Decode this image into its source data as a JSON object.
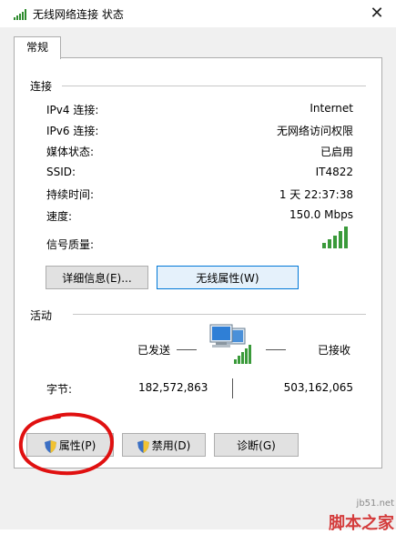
{
  "window": {
    "title": "无线网络连接 状态"
  },
  "tabs": [
    {
      "label": "常规"
    }
  ],
  "connection": {
    "header": "连接",
    "rows": [
      {
        "label": "IPv4 连接:",
        "value": "Internet"
      },
      {
        "label": "IPv6 连接:",
        "value": "无网络访问权限"
      },
      {
        "label": "媒体状态:",
        "value": "已启用"
      },
      {
        "label": "SSID:",
        "value": "IT4822"
      },
      {
        "label": "持续时间:",
        "value": "1 天 22:37:38"
      },
      {
        "label": "速度:",
        "value": "150.0 Mbps"
      },
      {
        "label": "信号质量:",
        "value": ""
      }
    ],
    "signal_bars": 5
  },
  "buttons_top": {
    "details": "详细信息(E)...",
    "wireless_props": "无线属性(W)"
  },
  "activity": {
    "header": "活动",
    "sent_label": "已发送",
    "received_label": "已接收",
    "bytes_label": "字节:",
    "bytes_sent": "182,572,863",
    "bytes_received": "503,162,065"
  },
  "buttons_bottom": {
    "properties": "属性(P)",
    "disable": "禁用(D)",
    "diagnose": "诊断(G)"
  },
  "watermark": {
    "small": "jb51.net",
    "large": "脚本之家"
  }
}
